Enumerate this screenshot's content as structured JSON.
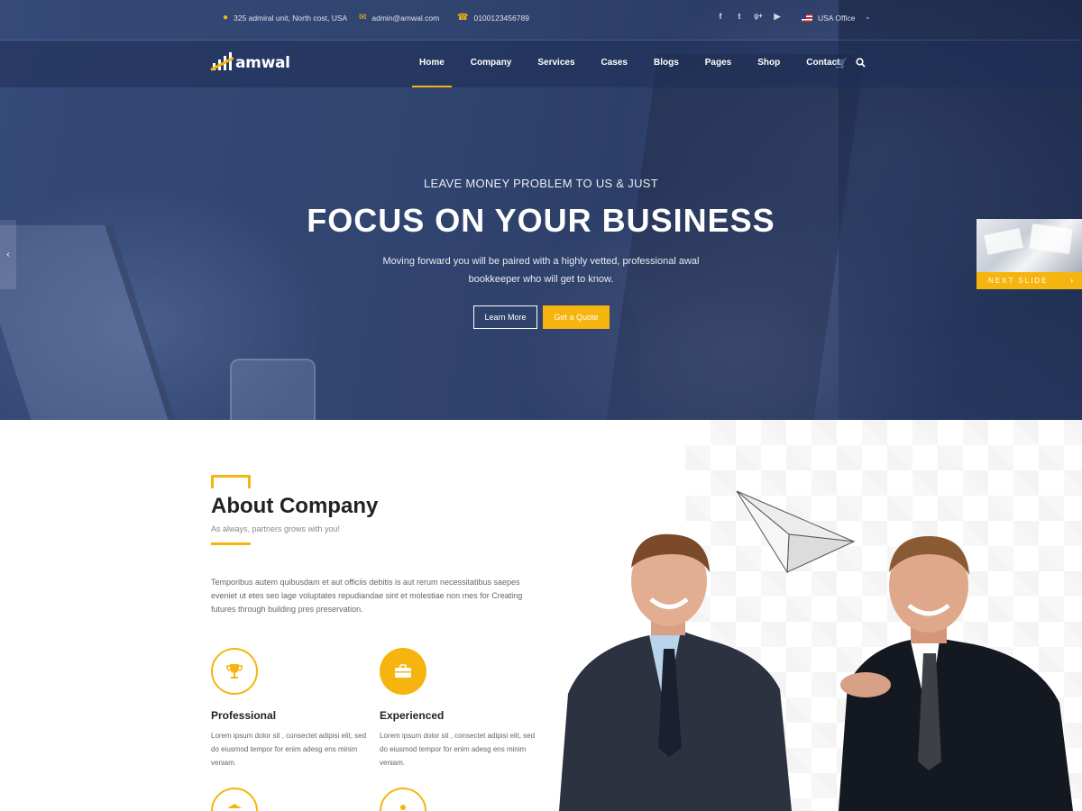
{
  "topbar": {
    "address": "325 admiral unit, North cost, USA",
    "email": "admin@amwal.com",
    "phone": "0100123456789",
    "office": "USA Office",
    "social": [
      "f",
      "t",
      "g+",
      "yt"
    ]
  },
  "logo": {
    "text": "amwal"
  },
  "nav": {
    "items": [
      "Home",
      "Company",
      "Services",
      "Cases",
      "Blogs",
      "Pages",
      "Shop",
      "Contact"
    ],
    "active": "Home"
  },
  "hero": {
    "subtitle": "LEAVE MONEY PROBLEM TO US & JUST",
    "title": "FOCUS ON YOUR BUSINESS",
    "description": "Moving forward you will be paired with a highly vetted, professional awal bookkeeper who will get to know.",
    "learn_more": "Learn More",
    "get_quote": "Get a Quote",
    "next_slide": "NEXT SLIDE"
  },
  "about": {
    "title": "About Company",
    "subtitle": "As always, partners grows with you!",
    "text": "Temporibus autem quibusdam et aut officiis debitis is aut rerum necessitatibus saepes eveniet ut etes seo lage voluptates repudiandae sint et molestiae non mes  for Creating futures through building pres preservation.",
    "features": [
      {
        "title": "Professional",
        "text": "Lorem ipsum dolor sit , consectet adipisi elit, sed do eiusmod tempor for enim adesg ens minim veniam.",
        "icon": "trophy-icon"
      },
      {
        "title": "Experienced",
        "text": "Lorem ipsum dolor sit , consectet adipisi elit, sed do eiusmod tempor for enim adesg ens minim veniam.",
        "icon": "briefcase-icon"
      }
    ]
  },
  "colors": {
    "accent": "#f6b50e",
    "hero_overlay": "#2f4471",
    "heading": "#222222"
  }
}
